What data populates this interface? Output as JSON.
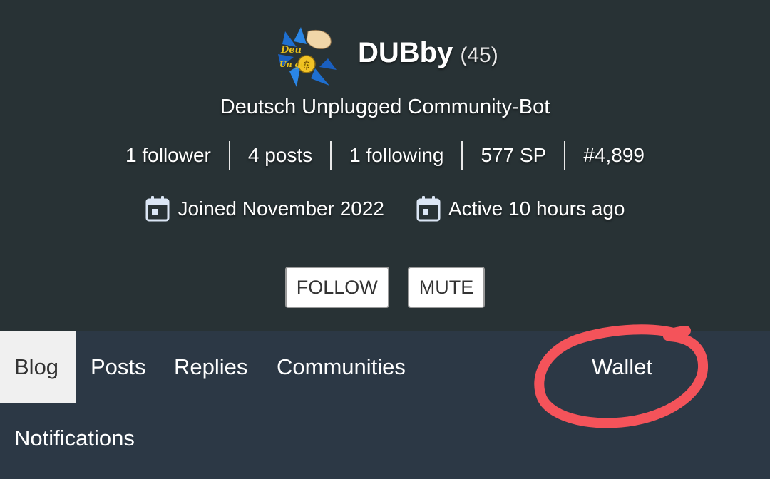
{
  "profile": {
    "username": "DUBby",
    "reputation": "(45)",
    "about": "Deutsch Unplugged Community-Bot",
    "avatar_icon": "community-logo-icon",
    "avatar_text_top": "Deu",
    "avatar_text_bottom": "Un  ged"
  },
  "stats": [
    {
      "label": "1 follower"
    },
    {
      "label": "4 posts"
    },
    {
      "label": "1 following"
    },
    {
      "label": "577 SP"
    },
    {
      "label": "#4,899"
    }
  ],
  "dates": {
    "joined": "Joined November 2022",
    "active": "Active 10 hours ago",
    "icon": "calendar-icon"
  },
  "buttons": {
    "follow": "FOLLOW",
    "mute": "MUTE"
  },
  "tabs": {
    "blog": "Blog",
    "posts": "Posts",
    "replies": "Replies",
    "communities": "Communities",
    "wallet": "Wallet",
    "notifications": "Notifications"
  },
  "colors": {
    "header_bg": "#283235",
    "nav_bg": "#2c3845",
    "active_tab_bg": "#f0f0f0",
    "highlight": "#f4535a"
  }
}
